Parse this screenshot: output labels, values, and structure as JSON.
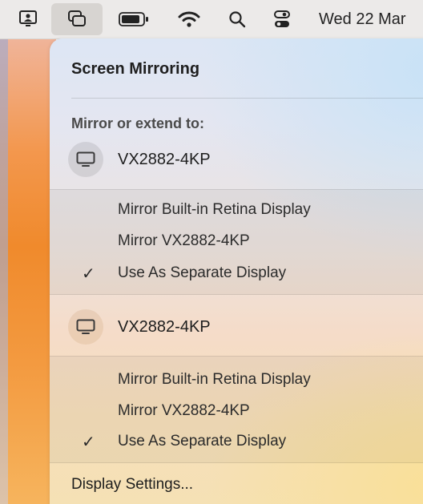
{
  "menubar": {
    "clock": "Wed 22 Mar",
    "icons": [
      "screen-sharing-icon",
      "screen-mirroring-icon",
      "battery-icon",
      "wifi-icon",
      "spotlight-search-icon",
      "control-center-icon"
    ]
  },
  "popover": {
    "title": "Screen Mirroring",
    "section_label": "Mirror or extend to:",
    "displays": [
      {
        "name": "VX2882-4KP",
        "options": [
          {
            "label": "Mirror Built-in Retina Display",
            "checked": false
          },
          {
            "label": "Mirror VX2882-4KP",
            "checked": false
          },
          {
            "label": "Use As Separate Display",
            "checked": true
          }
        ]
      },
      {
        "name": "VX2882-4KP",
        "options": [
          {
            "label": "Mirror Built-in Retina Display",
            "checked": false
          },
          {
            "label": "Mirror VX2882-4KP",
            "checked": false
          },
          {
            "label": "Use As Separate Display",
            "checked": true
          }
        ]
      }
    ],
    "checkmark_glyph": "✓",
    "settings_label": "Display Settings..."
  }
}
